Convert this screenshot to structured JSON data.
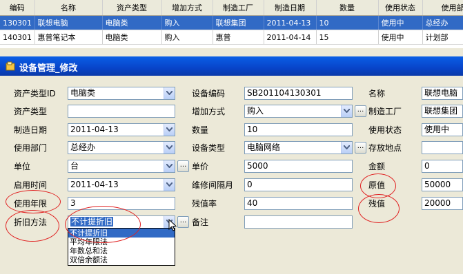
{
  "grid": {
    "columns": [
      "编码",
      "名称",
      "资产类型",
      "增加方式",
      "制造工厂",
      "制造日期",
      "数量",
      "使用状态",
      "使用部"
    ],
    "rows": [
      [
        "130301",
        "联想电脑",
        "电脑类",
        "购入",
        "联想集团",
        "2011-04-13",
        "10",
        "使用中",
        "总经办"
      ],
      [
        "140301",
        "惠普笔记本",
        "电脑类",
        "购入",
        "惠普",
        "2011-04-14",
        "15",
        "使用中",
        "计划部"
      ]
    ]
  },
  "window": {
    "title": "设备管理_修改"
  },
  "form": {
    "asset_type_id": {
      "label": "资产类型ID",
      "value": "电脑类"
    },
    "asset_type": {
      "label": "资产类型",
      "value": ""
    },
    "mfg_date": {
      "label": "制造日期",
      "value": "2011-04-13"
    },
    "department": {
      "label": "使用部门",
      "value": "总经办"
    },
    "unit": {
      "label": "单位",
      "value": "台"
    },
    "start_date": {
      "label": "启用时间",
      "value": "2011-04-13"
    },
    "life_years": {
      "label": "使用年限",
      "value": "3"
    },
    "depreciation": {
      "label": "折旧方法",
      "value": "不计提折旧",
      "options": [
        "不计提折旧",
        "平均年限法",
        "年数总和法",
        "双倍余额法"
      ]
    },
    "device_code": {
      "label": "设备编码",
      "value": "SB201104130301"
    },
    "add_method": {
      "label": "增加方式",
      "value": "购入"
    },
    "quantity": {
      "label": "数量",
      "value": "10"
    },
    "device_type": {
      "label": "设备类型",
      "value": "电脑网络"
    },
    "unit_price": {
      "label": "单价",
      "value": "5000"
    },
    "maint_interval": {
      "label": "维修间隔月",
      "value": "0"
    },
    "residual_rate": {
      "label": "残值率",
      "value": "40"
    },
    "remark": {
      "label": "备注",
      "value": ""
    },
    "name": {
      "label": "名称",
      "value": "联想电脑"
    },
    "factory": {
      "label": "制造工厂",
      "value": "联想集团"
    },
    "status": {
      "label": "使用状态",
      "value": "使用中"
    },
    "location": {
      "label": "存放地点",
      "value": ""
    },
    "amount": {
      "label": "金额",
      "value": "0"
    },
    "original_value": {
      "label": "原值",
      "value": "50000"
    },
    "residual_value": {
      "label": "残值",
      "value": "20000"
    }
  },
  "browse_label": "...",
  "colors": {
    "title_bar": "#0a5fe6",
    "selection": "#316ac5",
    "annotation": "#e02020"
  }
}
